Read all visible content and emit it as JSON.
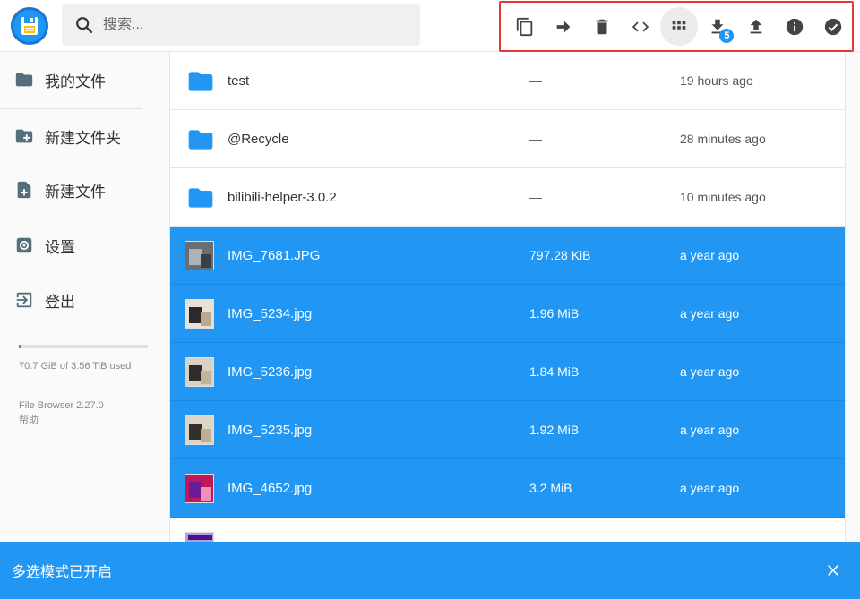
{
  "header": {
    "logo": "floppy-disk-icon",
    "search": {
      "placeholder": "搜索..."
    },
    "toolbar": {
      "buttons": [
        "copy-icon",
        "move-icon",
        "delete-icon",
        "code-icon",
        "grid-view-icon",
        "download-icon",
        "upload-icon",
        "info-icon",
        "check-icon"
      ],
      "download_badge": "5"
    }
  },
  "sidebar": {
    "items": [
      {
        "label": "我的文件",
        "icon": "folder-icon"
      },
      {
        "label": "新建文件夹",
        "icon": "folder-add-icon"
      },
      {
        "label": "新建文件",
        "icon": "file-add-icon"
      },
      {
        "label": "设置",
        "icon": "settings-icon"
      },
      {
        "label": "登出",
        "icon": "logout-icon"
      }
    ],
    "usage_text": "70.7 GiB of 3.56 TiB used",
    "usage_fraction": 0.02,
    "version": "File Browser 2.27.0",
    "help": "帮助"
  },
  "files": [
    {
      "name": "test",
      "size": "—",
      "modified": "19 hours ago",
      "type": "folder",
      "selected": false
    },
    {
      "name": "@Recycle",
      "size": "—",
      "modified": "28 minutes ago",
      "type": "folder",
      "selected": false
    },
    {
      "name": "bilibili-helper-3.0.2",
      "size": "—",
      "modified": "10 minutes ago",
      "type": "folder",
      "selected": false
    },
    {
      "name": "IMG_7681.JPG",
      "size": "797.28 KiB",
      "modified": "a year ago",
      "type": "image",
      "selected": true
    },
    {
      "name": "IMG_5234.jpg",
      "size": "1.96 MiB",
      "modified": "a year ago",
      "type": "image",
      "selected": true
    },
    {
      "name": "IMG_5236.jpg",
      "size": "1.84 MiB",
      "modified": "a year ago",
      "type": "image",
      "selected": true
    },
    {
      "name": "IMG_5235.jpg",
      "size": "1.92 MiB",
      "modified": "a year ago",
      "type": "image",
      "selected": true
    },
    {
      "name": "IMG_4652.jpg",
      "size": "3.2 MiB",
      "modified": "a year ago",
      "type": "image",
      "selected": true
    }
  ],
  "snackbar": {
    "text": "多选模式已开启",
    "close_icon": "close-icon"
  },
  "colors": {
    "accent": "#2196f3",
    "highlight_border": "#e53935"
  }
}
